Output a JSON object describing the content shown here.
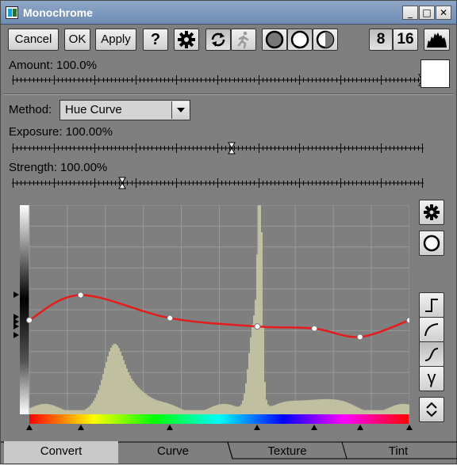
{
  "window": {
    "title": "Monochrome",
    "controls": {
      "minimize": "_",
      "maximize": "□",
      "close": "✕"
    }
  },
  "toolbar": {
    "cancel_label": "Cancel",
    "ok_label": "OK",
    "apply_label": "Apply",
    "help_label": "?",
    "bit8_label": "8",
    "bit16_label": "16"
  },
  "amount": {
    "label": "Amount: 100.0%",
    "value": 1.0,
    "swatch_color": "#ffffff"
  },
  "method": {
    "label": "Method:",
    "value": "Hue Curve"
  },
  "exposure": {
    "label": "Exposure: 100.00%",
    "value": 0.5348
  },
  "strength": {
    "label": "Strength: 100.00%",
    "value": 0.2665
  },
  "curve": {
    "color": "#e51c1c",
    "points": [
      {
        "hue": 0.0,
        "level": 0.45
      },
      {
        "hue": 0.135,
        "level": 0.57
      },
      {
        "hue": 0.37,
        "level": 0.46
      },
      {
        "hue": 0.6,
        "level": 0.42
      },
      {
        "hue": 0.75,
        "level": 0.41
      },
      {
        "hue": 0.87,
        "level": 0.37
      },
      {
        "hue": 1.0,
        "level": 0.45
      }
    ],
    "hue_markers": [
      0.0,
      0.135,
      0.37,
      0.6,
      0.75,
      0.87,
      1.0
    ]
  },
  "tabs": [
    {
      "label": "Convert",
      "active": true
    },
    {
      "label": "Curve",
      "active": false
    },
    {
      "label": "Texture",
      "active": false
    },
    {
      "label": "Tint",
      "active": false
    }
  ],
  "icons": [
    "gear-icon",
    "refresh-icon",
    "runner-icon",
    "circle-dark-icon",
    "circle-light-icon",
    "circle-half-icon",
    "histogram-icon",
    "step-curve-icon",
    "log-curve-icon",
    "s-curve-icon",
    "gamma-icon",
    "expand-icon"
  ],
  "side_buttons": {
    "gamma_label": "γ"
  }
}
